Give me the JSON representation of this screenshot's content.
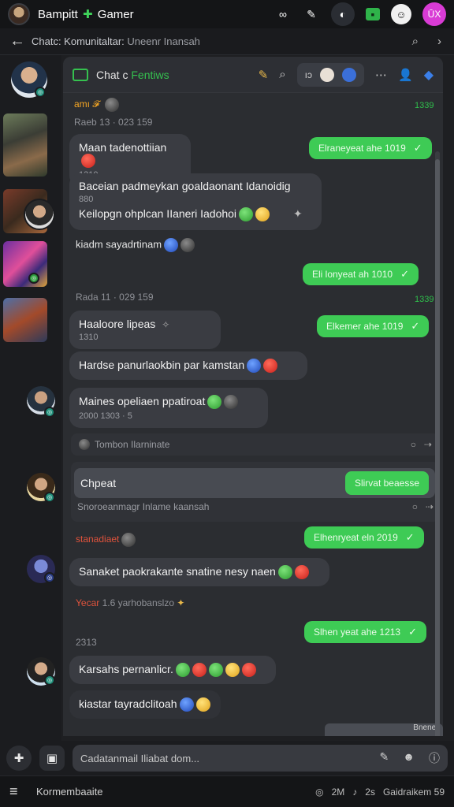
{
  "status_bar": {
    "app_title_a": "Bampitt",
    "app_title_icon": "✚",
    "app_title_b": "Gamer",
    "icons": [
      "infinity-icon",
      "tool-icon",
      "game-avatar",
      "green-square-icon",
      "face-icon",
      "profile-badge"
    ],
    "profile_badge": "ŪX"
  },
  "nav": {
    "back": "←",
    "breadcrumb_a": "Chatc: Komunitaltar:",
    "breadcrumb_b": "Uneenr Inansah",
    "search": "⌕",
    "next": "›"
  },
  "chat_header": {
    "title_a": "Chat c",
    "title_b": "Fentiws",
    "pill_label": "ıɔ"
  },
  "messages": {
    "m1_sender": "amı 𝓕",
    "m1_time": "1339",
    "m1_meta": "Raeb 13 · 023 159",
    "m2_text": "Maan tadenottiian",
    "m2_sub": "1310",
    "m3_text": "Elraneyeat ahe 1019",
    "m4_line1": "Baceian padmeykan goaldaonant Idanoidig",
    "m4_sub": "880",
    "m4_line2": "Keilopgn ohplcan IIaneri Iadohoi",
    "m5_text": "kiadm sayadrtinam",
    "m6_text": "Eli lonyeat ah 1010",
    "m7_meta": "Rada 11 · 029 159",
    "m7_time": "1339",
    "m8_text": "Haaloore lipeas",
    "m8_sub": "1310",
    "m9_text": "Elkemer ahe 1019",
    "m10_text": "Hardse panurlaokbin par kamstan",
    "m11_text": "Maines opeliaen ppatiroat",
    "m11_sub": "2000 1303 · 5",
    "sys1_text": "Tombon Ilarninate",
    "reply_label": "Chpeat",
    "reply_button": "Slirvat beaesse",
    "reply_sub": "Snoroeanmagr Inlame kaansah",
    "m12_sender": "stanadiaet",
    "m13_text": "Elhenryeat eln 2019",
    "m14_text": "Sanaket paokrakante snatine nesy naen",
    "m15_meta_red": "Yecar",
    "m15_meta": "1.6 yarhobanslzo",
    "m16_meta": "2313",
    "m17_text": "Slhen yeat ahe 1213",
    "m18_text": "Karsahs pernanlicr.",
    "m19_text": "kiastar tayradclitoah",
    "m20_text": "Bnenet"
  },
  "composer": {
    "placeholder": "Cadatanmail Iliabat dom..."
  },
  "bottom_bar": {
    "label": "Kormembaaite",
    "right_a": "2M",
    "right_b": "2s",
    "right_c": "Gaidraikem 59"
  },
  "colors": {
    "accent_green": "#3ecb55",
    "bubble_in": "#3a3c42",
    "panel_bg": "#2b2d31",
    "sender_orange": "#f5a623"
  }
}
